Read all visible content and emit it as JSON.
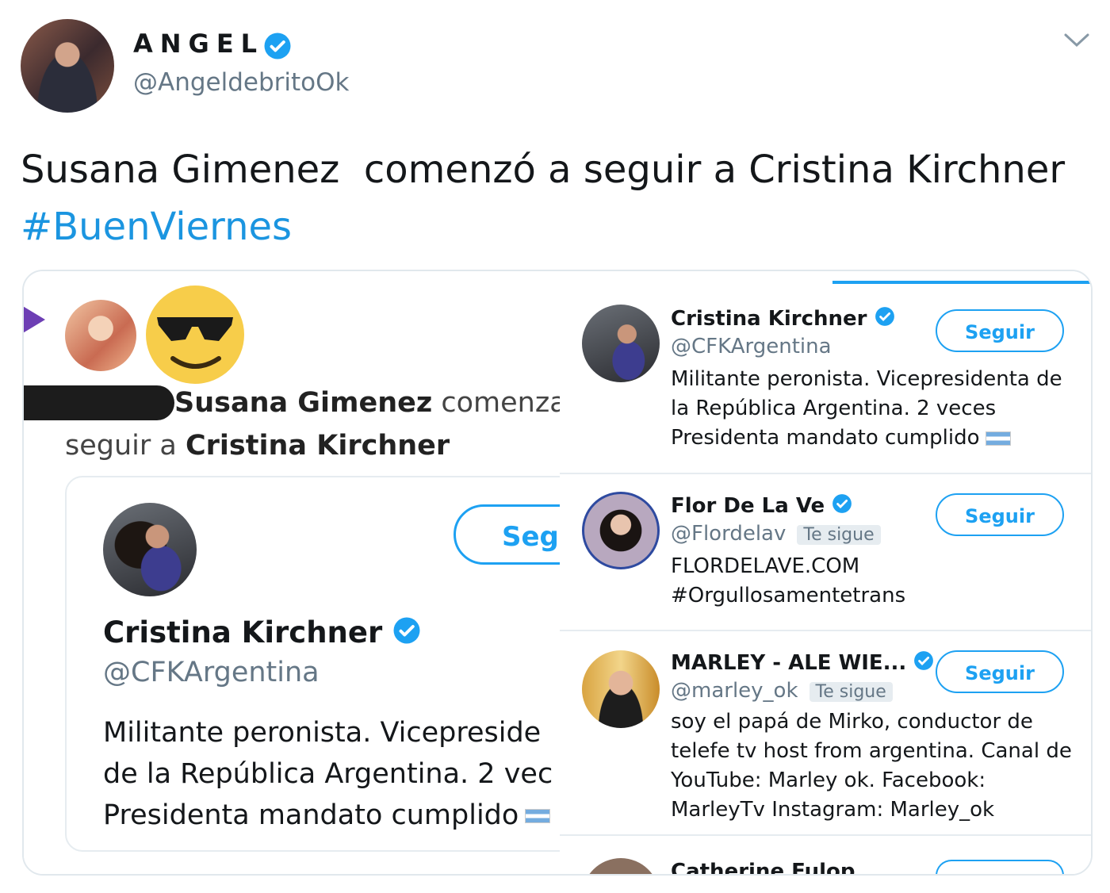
{
  "tweet": {
    "author_name": "ANGEL",
    "author_handle": "@AngeldebritoOk",
    "text": "Susana Gimenez  comenzó a seguir a Cristina Kirchner",
    "hashtag": "#BuenViernes"
  },
  "media": {
    "notification": {
      "actor": "Susana Gimenez",
      "verb_fragment": " comenza",
      "line2_prefix": "seguir a ",
      "target": "Cristina Kirchner"
    },
    "card": {
      "name": "Cristina Kirchner",
      "handle": "@CFKArgentina",
      "follow_label": "Seg",
      "bio_lines": [
        "Militante peronista. Vicepreside",
        "de la República Argentina. 2 vec",
        "Presidenta mandato cumplido"
      ]
    },
    "suggestions": [
      {
        "name": "Cristina Kirchner",
        "handle": "@CFKArgentina",
        "follows_you": "",
        "follow_label": "Seguir",
        "bio_lines": [
          "Militante peronista. Vicepresidenta de",
          "la República Argentina. 2 veces",
          "Presidenta mandato cumplido"
        ]
      },
      {
        "name": "Flor De La Ve",
        "handle": "@Flordelav",
        "follows_you": "Te sigue",
        "follow_label": "Seguir",
        "bio_lines": [
          "FLORDELAVE.COM",
          "#Orgullosamentetrans"
        ]
      },
      {
        "name": "MARLEY - ALE WIE...",
        "handle": "@marley_ok",
        "follows_you": "Te sigue",
        "follow_label": "Seguir",
        "bio_lines": [
          "soy el papá de Mirko, conductor de",
          "telefe tv host from argentina. Canal de",
          "YouTube: Marley ok. Facebook:",
          "MarleyTv Instagram: Marley_ok"
        ]
      },
      {
        "name": "Catherine Fulop",
        "partial": true
      }
    ]
  },
  "colors": {
    "link_blue": "#1b95e0",
    "verified_blue": "#1da1f2",
    "secondary_text": "#657786"
  },
  "icons": [
    "verified-icon",
    "chevron-down-icon",
    "sunglasses-emoji-icon",
    "argentina-flag-icon"
  ]
}
